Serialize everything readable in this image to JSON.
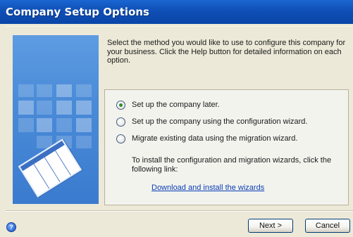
{
  "window": {
    "title": "Company Setup Options"
  },
  "description": "Select the method you would like to use to configure this company for your business. Click the Help button for detailed information on each option.",
  "options": [
    {
      "label": "Set up the company later.",
      "selected": true
    },
    {
      "label": "Set up the company using the configuration wizard.",
      "selected": false
    },
    {
      "label": "Migrate existing data using the migration wizard.",
      "selected": false
    }
  ],
  "install": {
    "text": "To install the configuration and migration wizards, click the following link:",
    "link": "Download and install the wizards"
  },
  "buttons": {
    "next": "Next >",
    "cancel": "Cancel"
  },
  "help_icon": {
    "glyph": "?"
  },
  "colors": {
    "title_bar": "#0f4fb6",
    "sidebar": "#4a8bd8",
    "link": "#0a3db6",
    "selected_radio": "#2e8f2e"
  }
}
